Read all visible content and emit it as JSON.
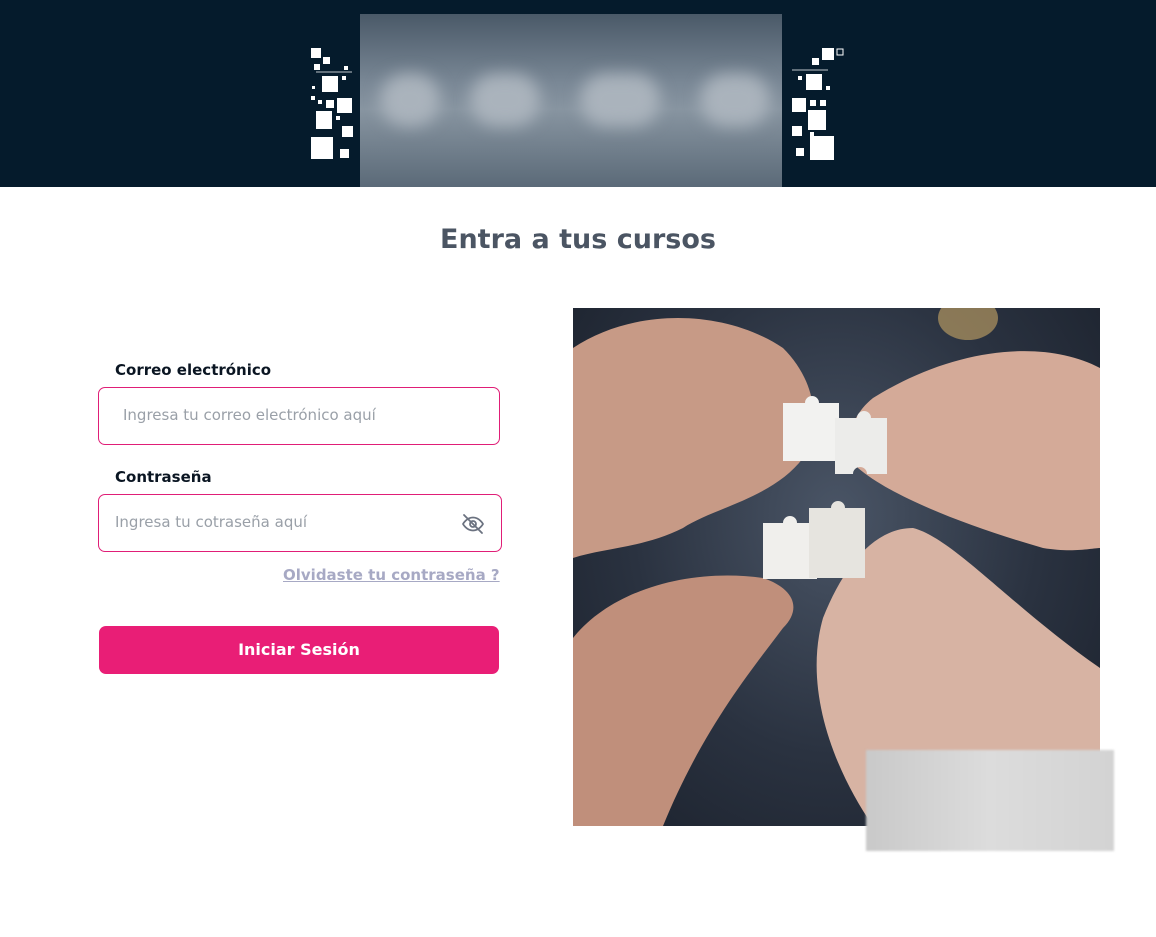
{
  "header": {
    "banner_logo": "blurred-logo",
    "colors": {
      "background": "#051b2c"
    }
  },
  "page": {
    "title": "Entra a tus cursos"
  },
  "form": {
    "email_label": "Correo electrónico",
    "email_placeholder": "Ingresa tu correo electrónico aquí",
    "password_label": "Contraseña",
    "password_placeholder": "Ingresa tu cotraseña aquí",
    "toggle_icon": "eye-off-icon",
    "forgot_link": "Olvidaste tu contraseña ?",
    "submit_label": "Iniciar Sesión"
  },
  "image": {
    "description_icon": "puzzle-hands-photo"
  },
  "colors": {
    "accent": "#e91e76",
    "field_border": "#e01e77",
    "title": "#4b5563",
    "link": "#a7a9c4"
  }
}
